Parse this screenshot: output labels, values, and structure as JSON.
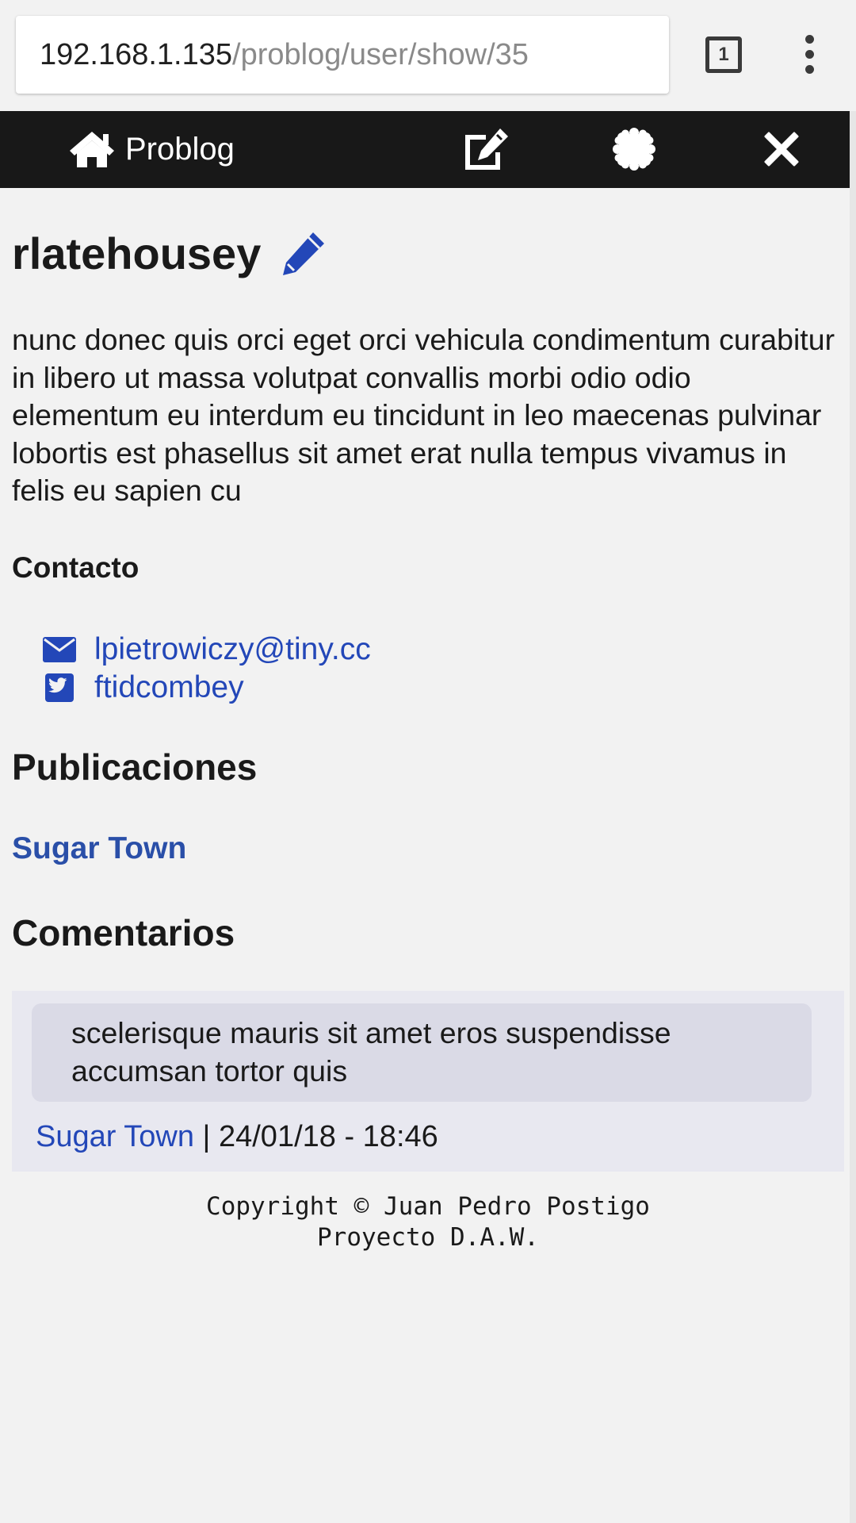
{
  "browser": {
    "url_host": "192.168.1.135",
    "url_path": "/problog/user/show/35",
    "tab_count": "1"
  },
  "navbar": {
    "brand_label": "Problog",
    "icons": [
      "home-icon",
      "edit-square-icon",
      "certificate-icon",
      "close-icon"
    ]
  },
  "profile": {
    "username": "rlatehousey",
    "bio": "nunc donec quis orci eget orci vehicula condimentum curabitur in libero ut massa volutpat convallis morbi odio odio elementum eu interdum eu tincidunt in leo maecenas pulvinar lobortis est phasellus sit amet erat nulla tempus vivamus in felis eu sapien cu"
  },
  "contact": {
    "heading": "Contacto",
    "email": "lpietrowiczy@tiny.cc",
    "twitter": "ftidcombey"
  },
  "publications": {
    "heading": "Publicaciones",
    "items": [
      {
        "title": "Sugar Town"
      }
    ]
  },
  "comments": {
    "heading": "Comentarios",
    "items": [
      {
        "text": "scelerisque mauris sit amet eros suspendisse accumsan tortor quis",
        "post_title": "Sugar Town",
        "separator": " | ",
        "datetime": "24/01/18 - 18:46"
      }
    ]
  },
  "footer": {
    "line1": "Copyright © Juan Pedro Postigo",
    "line2": "Proyecto D.A.W."
  },
  "colors": {
    "navbar_bg": "#181818",
    "link": "#2347b8",
    "page_bg": "#f2f2f2",
    "comment_card_bg": "#e8e8f0",
    "comment_bubble_bg": "#dadae6"
  }
}
